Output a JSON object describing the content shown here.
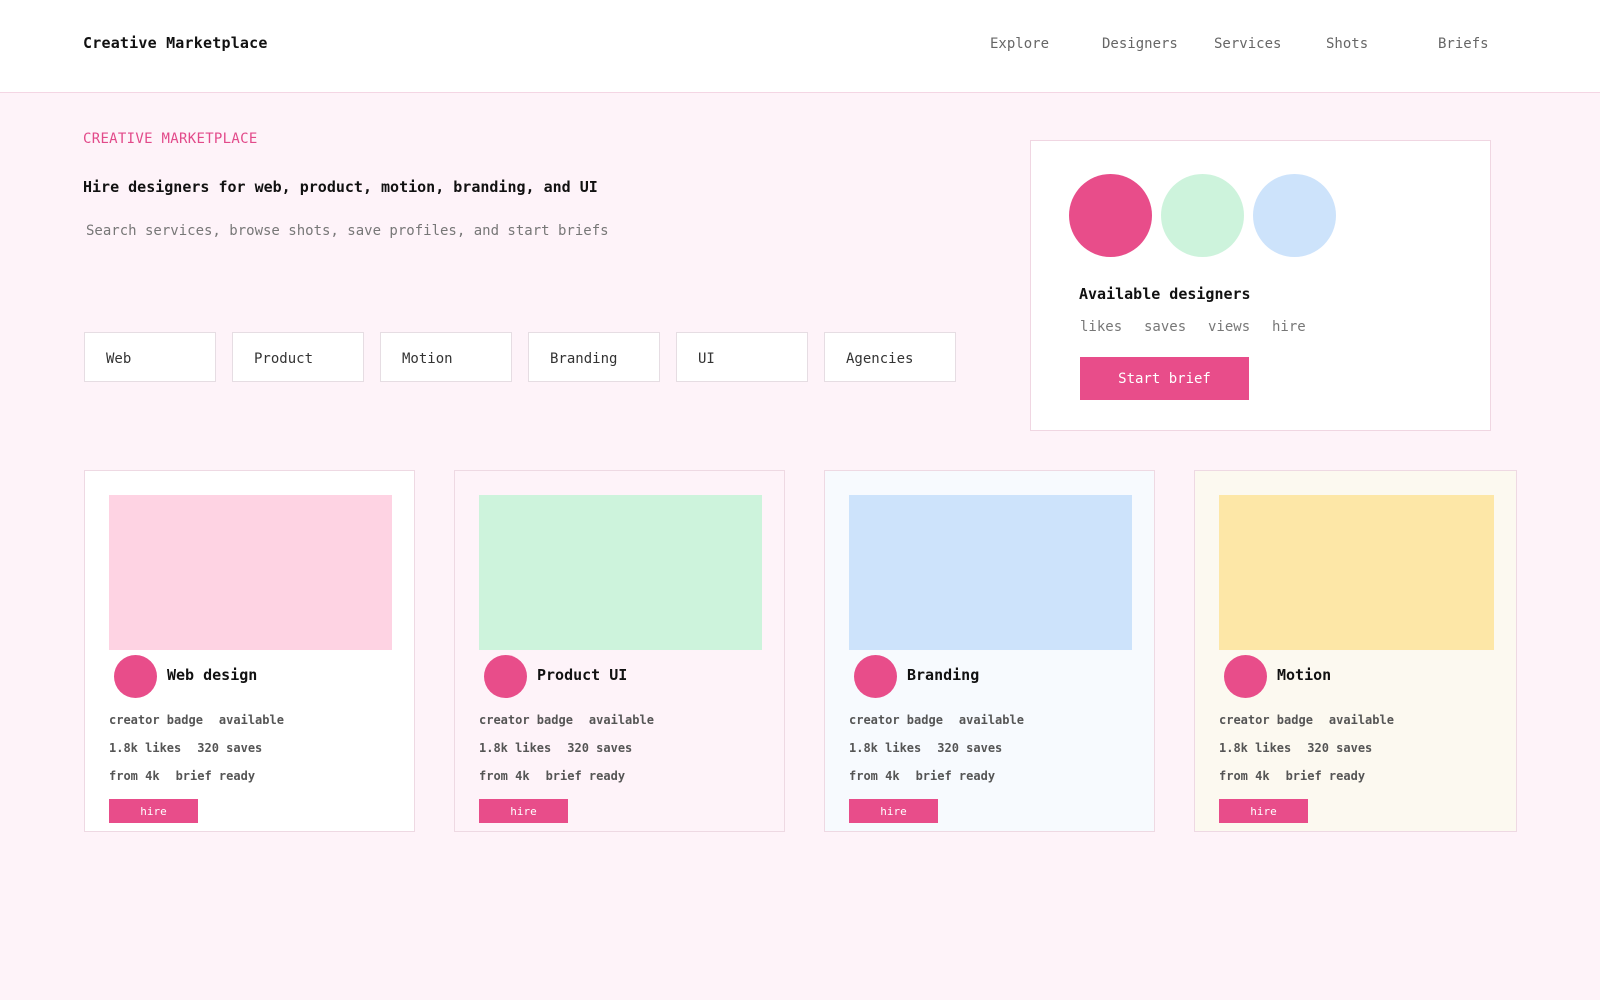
{
  "header": {
    "brand": "Creative Marketplace",
    "nav": [
      "Explore",
      "Designers",
      "Services",
      "Shots",
      "Briefs"
    ]
  },
  "hero": {
    "eyebrow": "CREATIVE MARKETPLACE",
    "headline": "Hire designers for web, product, motion, branding, and UI",
    "subhead": "Search services, browse shots, save profiles, and start briefs"
  },
  "filters": [
    "Web",
    "Product",
    "Motion",
    "Branding",
    "UI",
    "Agencies"
  ],
  "panel": {
    "avatar_colors": [
      "#e84d8a",
      "#cdf3dc",
      "#cde3fb"
    ],
    "title": "Available designers",
    "stats": [
      "likes",
      "saves",
      "views",
      "hire"
    ],
    "cta": "Start brief"
  },
  "cards": [
    {
      "title": "Web design",
      "thumb_color": "#fed3e3",
      "bg_color": "#ffffff",
      "badge": "creator badge",
      "status": "available",
      "likes": "1.8k likes",
      "saves": "320 saves",
      "price": "from 4k",
      "brief": "brief ready",
      "cta": "hire"
    },
    {
      "title": "Product UI",
      "thumb_color": "#cdf3dc",
      "bg_color": "#fef3f9",
      "badge": "creator badge",
      "status": "available",
      "likes": "1.8k likes",
      "saves": "320 saves",
      "price": "from 4k",
      "brief": "brief ready",
      "cta": "hire"
    },
    {
      "title": "Branding",
      "thumb_color": "#cde3fb",
      "bg_color": "#f7fafe",
      "badge": "creator badge",
      "status": "available",
      "likes": "1.8k likes",
      "saves": "320 saves",
      "price": "from 4k",
      "brief": "brief ready",
      "cta": "hire"
    },
    {
      "title": "Motion",
      "thumb_color": "#fde7a7",
      "bg_color": "#fcf9f0",
      "badge": "creator badge",
      "status": "available",
      "likes": "1.8k likes",
      "saves": "320 saves",
      "price": "from 4k",
      "brief": "brief ready",
      "cta": "hire"
    }
  ]
}
